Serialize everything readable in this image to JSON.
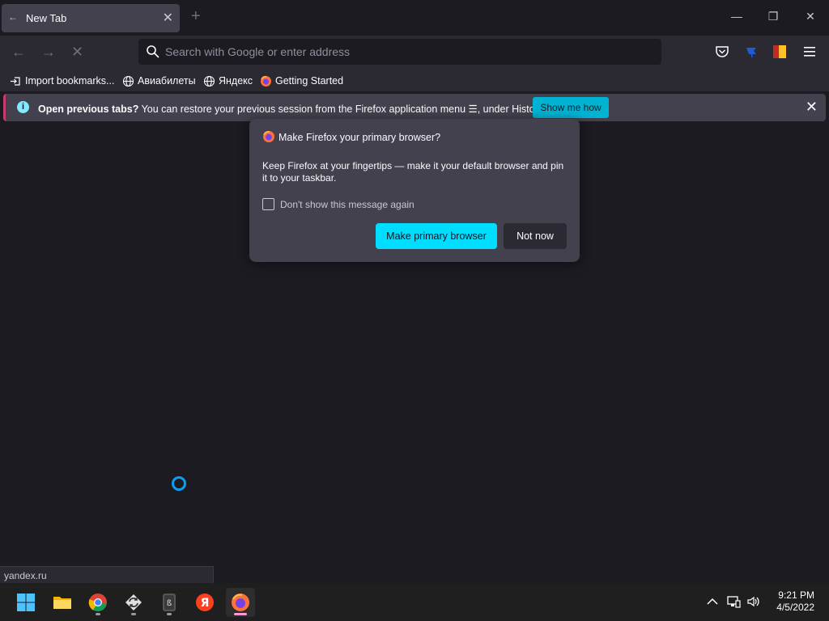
{
  "tab": {
    "title": "New Tab",
    "close_glyph": "✕"
  },
  "window_controls": {
    "minimize": "—",
    "restore": "❐",
    "close": "✕"
  },
  "urlbar": {
    "placeholder": "Search with Google or enter address"
  },
  "bookmarks": [
    {
      "label": "Import bookmarks...",
      "icon": "import-icon"
    },
    {
      "label": "Авиабилеты",
      "icon": "globe-icon"
    },
    {
      "label": "Яндекс",
      "icon": "globe-icon"
    },
    {
      "label": "Getting Started",
      "icon": "firefox-icon"
    }
  ],
  "notification": {
    "bold": "Open previous tabs?",
    "text": " You can restore your previous session from the Firefox application menu ☰, under History.",
    "button": "Show me how"
  },
  "dialog": {
    "title": "Make Firefox your primary browser?",
    "body": "Keep Firefox at your fingertips — make it your default browser and pin it to your taskbar.",
    "checkbox_label": "Don't show this message again",
    "primary_button": "Make primary browser",
    "secondary_button": "Not now"
  },
  "status": {
    "text": "yandex.ru"
  },
  "clock": {
    "time": "9:21 PM",
    "date": "4/5/2022"
  },
  "colors": {
    "accent": "#00ddff",
    "notif_button": "#00b3d3",
    "background": "#1c1b22"
  }
}
